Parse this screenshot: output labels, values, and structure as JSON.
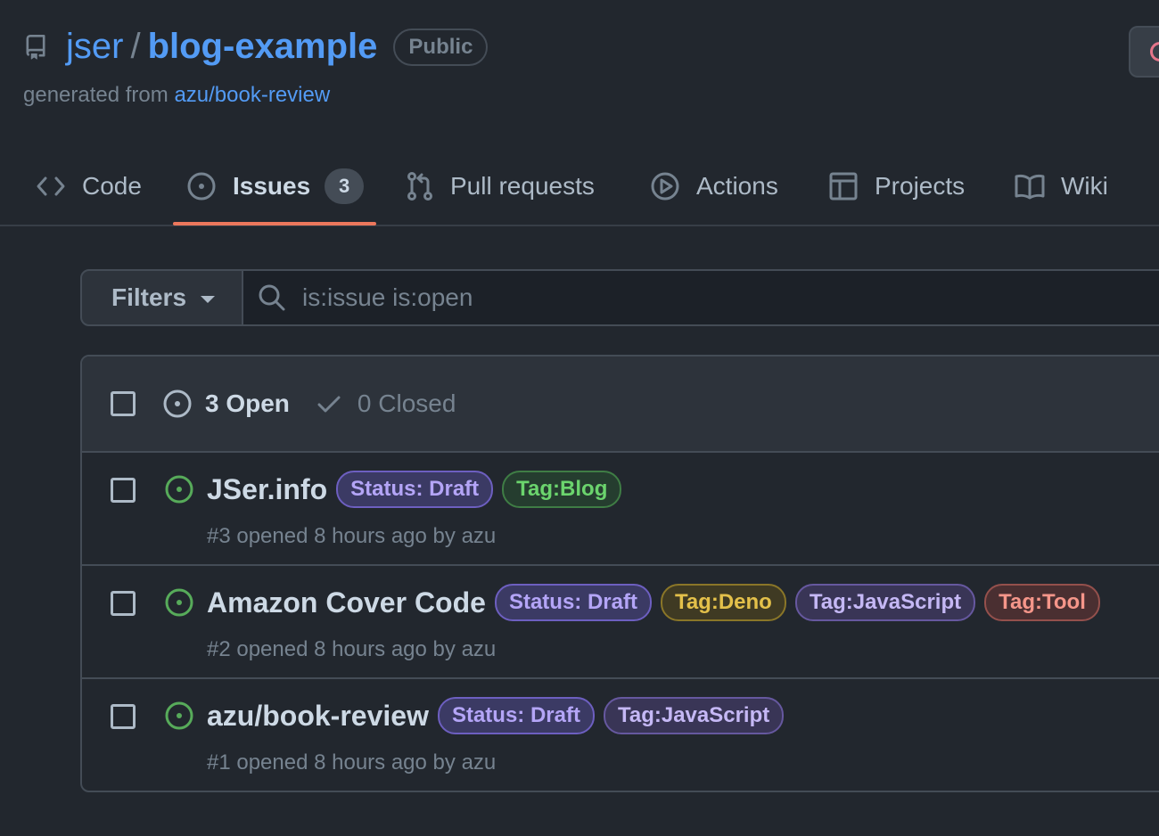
{
  "repo": {
    "owner": "jser",
    "separator": "/",
    "name": "blog-example",
    "visibility": "Public",
    "generated_prefix": "generated from",
    "generated_source": "azu/book-review"
  },
  "nav": {
    "tabs": [
      {
        "label": "Code",
        "icon": "code-icon"
      },
      {
        "label": "Issues",
        "icon": "issue-opened-icon",
        "counter": "3",
        "selected": true
      },
      {
        "label": "Pull requests",
        "icon": "git-pull-request-icon"
      },
      {
        "label": "Actions",
        "icon": "play-icon"
      },
      {
        "label": "Projects",
        "icon": "table-icon"
      },
      {
        "label": "Wiki",
        "icon": "book-icon"
      }
    ]
  },
  "filter": {
    "button_label": "Filters",
    "search_value": "is:issue is:open"
  },
  "issues": {
    "open_label": "3 Open",
    "closed_label": "0 Closed",
    "items": [
      {
        "title": "JSer.info",
        "meta": "#3 opened 8 hours ago by azu",
        "labels": [
          {
            "text": "Status: Draft",
            "color": "#b4a5f7",
            "bg": "#3b3a64",
            "border": "#6d5fc0"
          },
          {
            "text": "Tag:Blog",
            "color": "#6bd46d",
            "bg": "#253d2f",
            "border": "#3f7d45"
          }
        ]
      },
      {
        "title": "Amazon Cover Code",
        "meta": "#2 opened 8 hours ago by azu",
        "labels": [
          {
            "text": "Status: Draft",
            "color": "#b4a5f7",
            "bg": "#3b3a64",
            "border": "#6d5fc0"
          },
          {
            "text": "Tag:Deno",
            "color": "#e3c04a",
            "bg": "#3f3a23",
            "border": "#8a7628"
          },
          {
            "text": "Tag:JavaScript",
            "color": "#c5b8f5",
            "bg": "#393556",
            "border": "#66589f"
          },
          {
            "text": "Tag:Tool",
            "color": "#f5968a",
            "bg": "#4a2f31",
            "border": "#94504c"
          }
        ]
      },
      {
        "title": "azu/book-review",
        "meta": "#1 opened 8 hours ago by azu",
        "labels": [
          {
            "text": "Status: Draft",
            "color": "#b4a5f7",
            "bg": "#3b3a64",
            "border": "#6d5fc0"
          },
          {
            "text": "Tag:JavaScript",
            "color": "#c5b8f5",
            "bg": "#393556",
            "border": "#66589f"
          }
        ]
      }
    ]
  },
  "colors": {
    "background": "#22272e",
    "accent_link": "#539bf5",
    "open_green": "#57ab5a",
    "tab_underline": "#ec775c"
  }
}
